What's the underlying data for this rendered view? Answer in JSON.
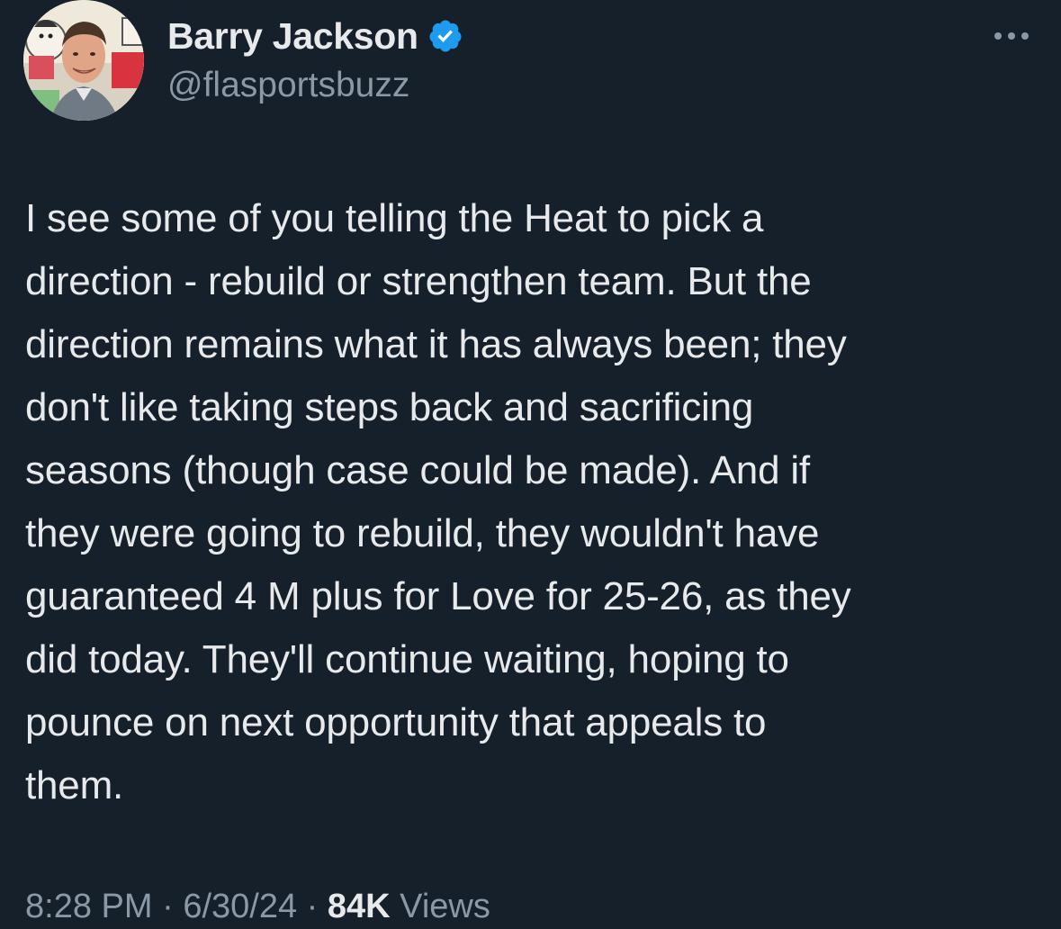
{
  "author": {
    "display_name": "Barry Jackson",
    "handle": "@flasportsbuzz",
    "verified": true,
    "avatar_icon": "avatar-photo"
  },
  "tweet": {
    "text": "I see some of you telling the Heat to pick a\ndirection - rebuild or strengthen team. But the\ndirection remains what it has always been; they\ndon't like taking steps back and sacrificing\nseasons (though case could be made). And if\nthey were going to rebuild, they wouldn't have\nguaranteed 4 M plus for Love for 25-26, as they\ndid today. They'll continue waiting, hoping to\npounce on next opportunity that appeals to\nthem.",
    "time": "8:28 PM",
    "separator": " · ",
    "date": "6/30/24",
    "views_count": "84K",
    "views_label": "Views"
  },
  "icons": {
    "verified": "verified-badge-icon",
    "more": "more-options-icon"
  },
  "colors": {
    "background": "#15202b",
    "primary_text": "#e7e9ea",
    "secondary_text": "#8b98a5",
    "verified": "#1d9bf0"
  }
}
